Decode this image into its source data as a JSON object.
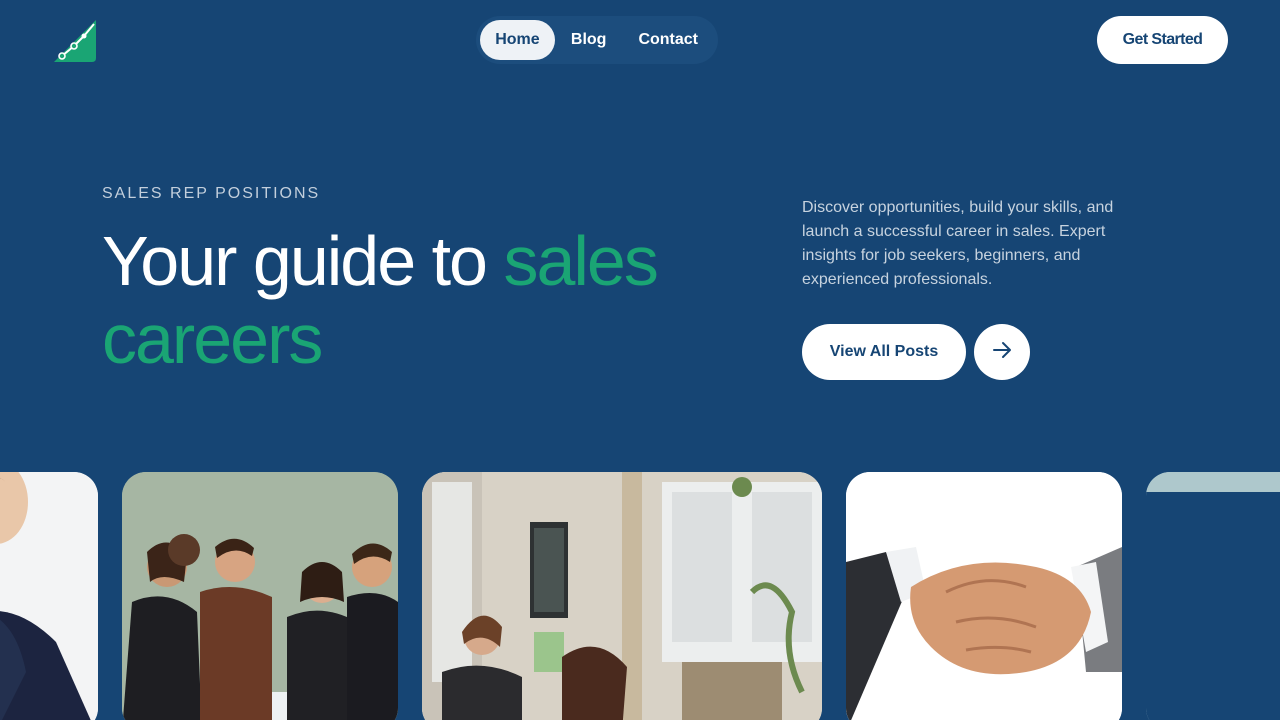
{
  "nav": {
    "items": [
      {
        "label": "Home",
        "active": true
      },
      {
        "label": "Blog",
        "active": false
      },
      {
        "label": "Contact",
        "active": false
      }
    ],
    "cta_label": "Get Started"
  },
  "hero": {
    "eyebrow": "SALES REP POSITIONS",
    "headline_main": "Your guide to ",
    "headline_accent": "sales careers",
    "description": "Discover opportunities, build your skills, and launch a successful career in sales. Expert insights for job seekers, beginners, and experienced professionals.",
    "primary_button": "View All Posts",
    "arrow_icon": "arrow-right-icon"
  },
  "gallery": {
    "images": [
      "businesswoman-portrait",
      "team-meeting-around-table",
      "office-coworkers-at-window",
      "business-handshake",
      "partial-image"
    ]
  },
  "colors": {
    "background": "#164574",
    "accent": "#1aa574",
    "button_bg": "#ffffff",
    "button_text": "#164574"
  }
}
